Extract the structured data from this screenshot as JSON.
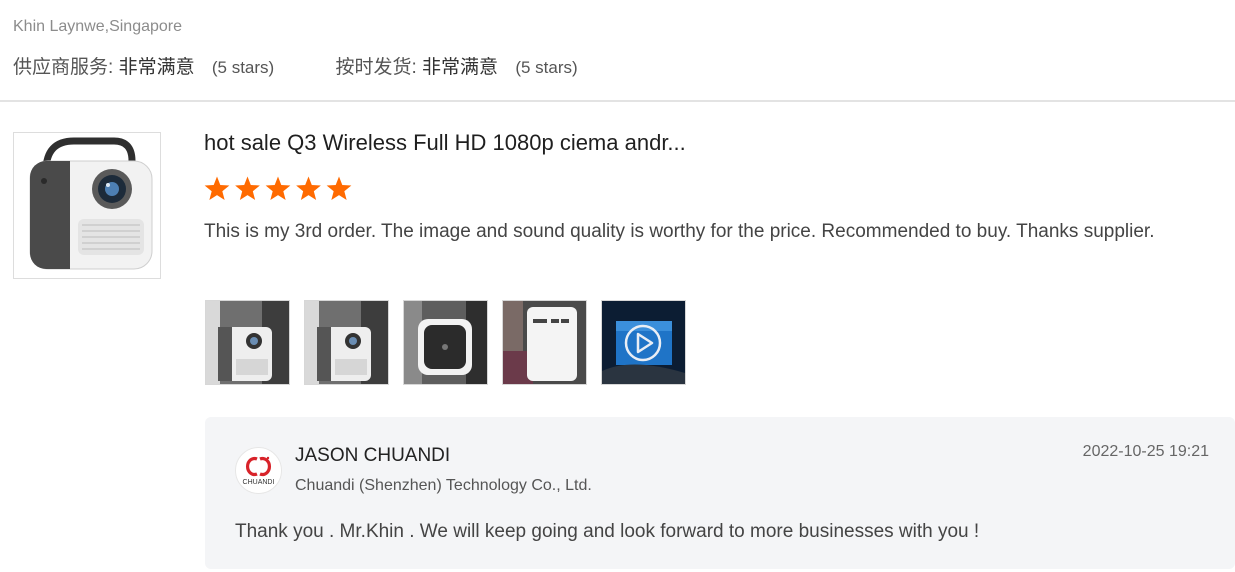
{
  "reviewer": {
    "name_location": "Khin Laynwe,Singapore",
    "ratings": [
      {
        "label": "供应商服务:",
        "value": "非常满意",
        "stars_text": "(5 stars)"
      },
      {
        "label": "按时发货:",
        "value": "非常满意",
        "stars_text": "(5 stars)"
      }
    ]
  },
  "review": {
    "product_title": "hot sale Q3 Wireless Full HD 1080p ciema andr...",
    "rating": 5,
    "text": "This is my 3rd order. The image and sound quality is worthy for the price. Recommended to buy. Thanks supplier.",
    "star_color": "#ff6a00"
  },
  "reply": {
    "seller_name": "JASON CHUANDI",
    "company": "Chuandi (Shenzhen) Technology Co., Ltd.",
    "timestamp": "2022-10-25 19:21",
    "text": "Thank you . Mr.Khin . We will keep going and look forward to more businesses with you !",
    "logo_text": "CHUANDI"
  }
}
